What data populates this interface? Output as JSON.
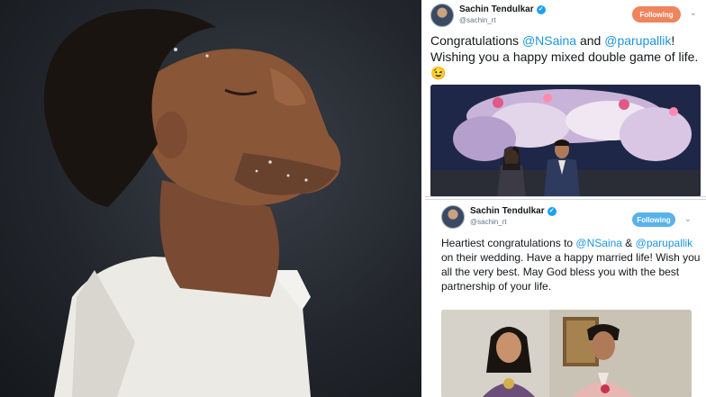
{
  "tweets": [
    {
      "name": "Sachin Tendulkar",
      "handle": "@sachin_rt",
      "follow_label": "Following",
      "text_parts": [
        "Congratulations ",
        "@NSaina",
        " and ",
        "@parupallik",
        "! Wishing you a happy mixed double game of life. ",
        "😉"
      ]
    },
    {
      "name": "Sachin Tendulkar",
      "handle": "@sachin_rt",
      "follow_label": "Following",
      "text_parts": [
        "Heartiest congratulations to ",
        "@NSaina",
        " & ",
        "@parupallik",
        " on their wedding. Have a happy married life! Wish you all the very best. May God bless you with the best partnership of your life."
      ]
    }
  ],
  "icons": {
    "verified": "✓",
    "chevron": "⌄"
  },
  "colors": {
    "mention": "#1b95e0",
    "verified": "#1da1f2",
    "follow_top": "#f0845c",
    "follow_bottom": "#5ab2ea"
  }
}
